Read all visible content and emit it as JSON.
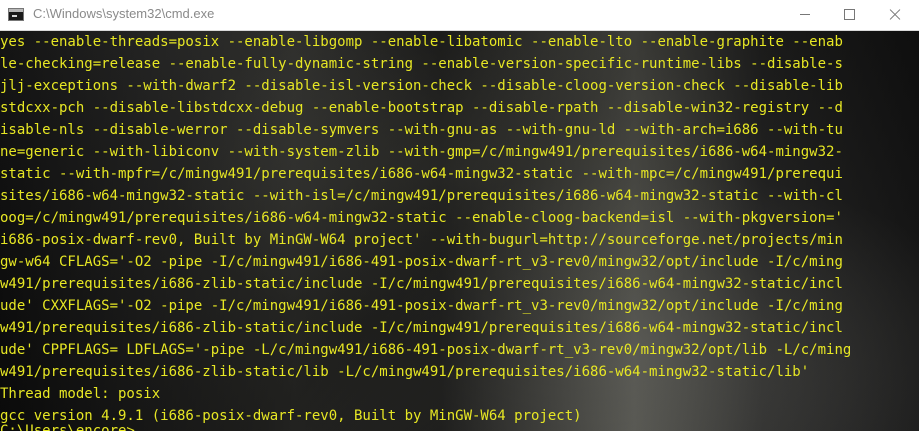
{
  "window": {
    "title": "C:\\Windows\\system32\\cmd.exe"
  },
  "console": {
    "lines": [
      "yes --enable-threads=posix --enable-libgomp --enable-libatomic --enable-lto --enable-graphite --enab",
      "le-checking=release --enable-fully-dynamic-string --enable-version-specific-runtime-libs --disable-s",
      "jlj-exceptions --with-dwarf2 --disable-isl-version-check --disable-cloog-version-check --disable-lib",
      "stdcxx-pch --disable-libstdcxx-debug --enable-bootstrap --disable-rpath --disable-win32-registry --d",
      "isable-nls --disable-werror --disable-symvers --with-gnu-as --with-gnu-ld --with-arch=i686 --with-tu",
      "ne=generic --with-libiconv --with-system-zlib --with-gmp=/c/mingw491/prerequisites/i686-w64-mingw32-",
      "static --with-mpfr=/c/mingw491/prerequisites/i686-w64-mingw32-static --with-mpc=/c/mingw491/prerequi",
      "sites/i686-w64-mingw32-static --with-isl=/c/mingw491/prerequisites/i686-w64-mingw32-static --with-cl",
      "oog=/c/mingw491/prerequisites/i686-w64-mingw32-static --enable-cloog-backend=isl --with-pkgversion='",
      "i686-posix-dwarf-rev0, Built by MinGW-W64 project' --with-bugurl=http://sourceforge.net/projects/min",
      "gw-w64 CFLAGS='-O2 -pipe -I/c/mingw491/i686-491-posix-dwarf-rt_v3-rev0/mingw32/opt/include -I/c/ming",
      "w491/prerequisites/i686-zlib-static/include -I/c/mingw491/prerequisites/i686-w64-mingw32-static/incl",
      "ude' CXXFLAGS='-O2 -pipe -I/c/mingw491/i686-491-posix-dwarf-rt_v3-rev0/mingw32/opt/include -I/c/ming",
      "w491/prerequisites/i686-zlib-static/include -I/c/mingw491/prerequisites/i686-w64-mingw32-static/incl",
      "ude' CPPFLAGS= LDFLAGS='-pipe -L/c/mingw491/i686-491-posix-dwarf-rt_v3-rev0/mingw32/opt/lib -L/c/ming",
      "w491/prerequisites/i686-zlib-static/lib -L/c/mingw491/prerequisites/i686-w64-mingw32-static/lib'",
      "Thread model: posix",
      "gcc version 4.9.1 (i686-posix-dwarf-rev0, Built by MinGW-W64 project)",
      "",
      "C:\\Users\\encore>"
    ]
  }
}
